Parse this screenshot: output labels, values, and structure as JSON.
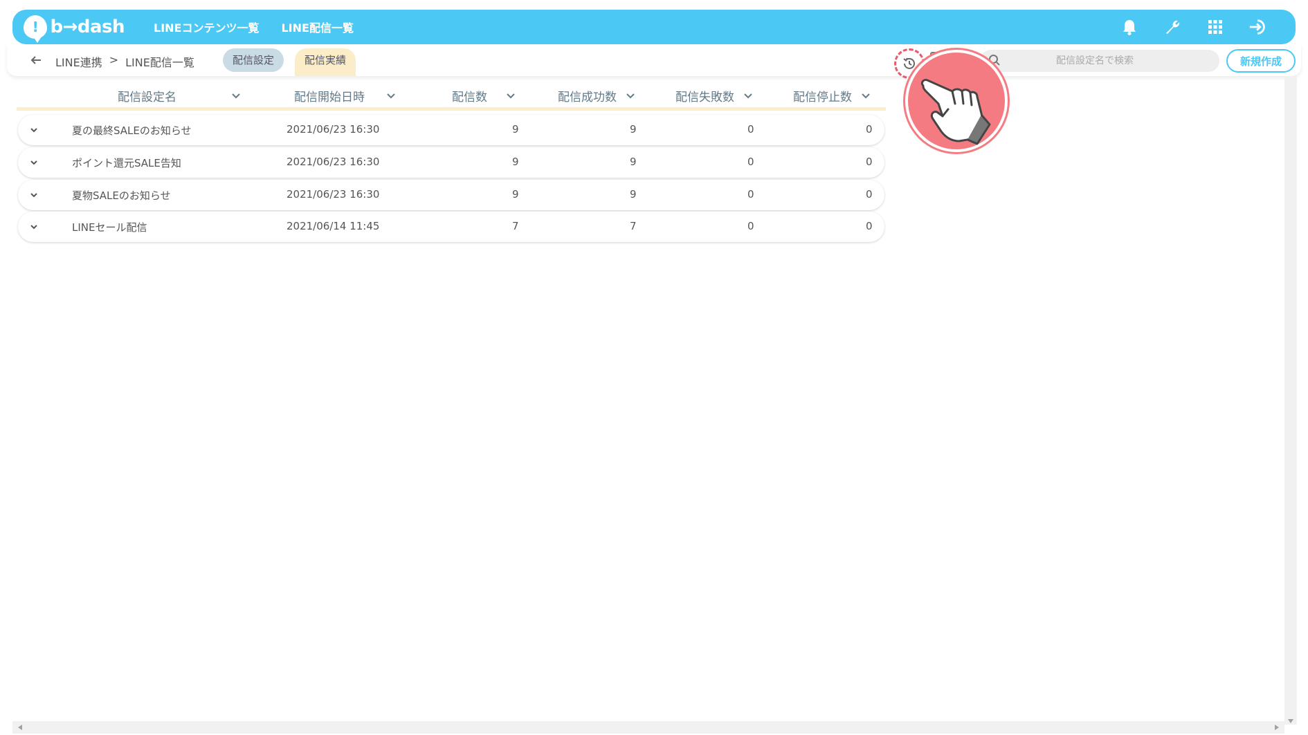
{
  "header": {
    "logo_text": "b→dash",
    "nav": [
      "LINEコンテンツ一覧",
      "LINE配信一覧"
    ],
    "icons": [
      "bell-icon",
      "wrench-icon",
      "grid-icon",
      "logout-icon"
    ]
  },
  "subbar": {
    "breadcrumb": [
      "LINE連携",
      ">",
      "LINE配信一覧"
    ],
    "tabs": [
      "配信設定",
      "配信実績"
    ],
    "active_tab": "配信実績",
    "search_placeholder": "配信設定名で検索",
    "new_button": "新規作成"
  },
  "table": {
    "columns": [
      "配信設定名",
      "配信開始日時",
      "配信数",
      "配信成功数",
      "配信失敗数",
      "配信停止数"
    ],
    "rows": [
      {
        "name": "夏の最終SALEのお知らせ",
        "start": "2021/06/23 16:30",
        "sent": "9",
        "success": "9",
        "failed": "0",
        "stopped": "0"
      },
      {
        "name": "ポイント還元SALE告知",
        "start": "2021/06/23 16:30",
        "sent": "9",
        "success": "9",
        "failed": "0",
        "stopped": "0"
      },
      {
        "name": "夏物SALEのお知らせ",
        "start": "2021/06/23 16:30",
        "sent": "9",
        "success": "9",
        "failed": "0",
        "stopped": "0"
      },
      {
        "name": "LINEセール配信",
        "start": "2021/06/14 11:45",
        "sent": "7",
        "success": "7",
        "failed": "0",
        "stopped": "0"
      }
    ]
  },
  "colors": {
    "header_blue": "#4cc8f4",
    "tab_active": "#fbedc7",
    "tab_inactive": "#c9dce6",
    "highlight_red": "#e85b6a",
    "hand_bg": "#f47b82"
  }
}
